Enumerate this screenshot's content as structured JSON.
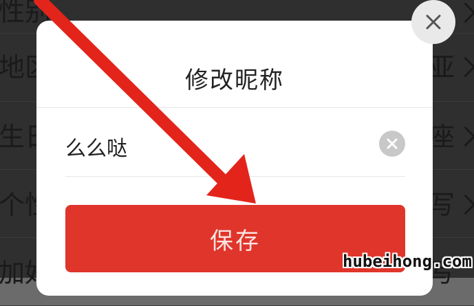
{
  "background_list": {
    "rows": [
      {
        "label": "性别",
        "value": ""
      },
      {
        "label": "地区",
        "value": "亚"
      },
      {
        "label": "生日",
        "value": "座"
      },
      {
        "label": "个性",
        "value": "写"
      },
      {
        "label": "加好",
        "value": "写"
      }
    ]
  },
  "dialog": {
    "title": "修改昵称",
    "nickname_value": "么么哒",
    "save_label": "保存",
    "close_icon": "close-icon",
    "clear_icon": "clear-icon"
  },
  "annotation": {
    "arrow_color": "#e3241b"
  },
  "watermark": "hubeihong.com"
}
